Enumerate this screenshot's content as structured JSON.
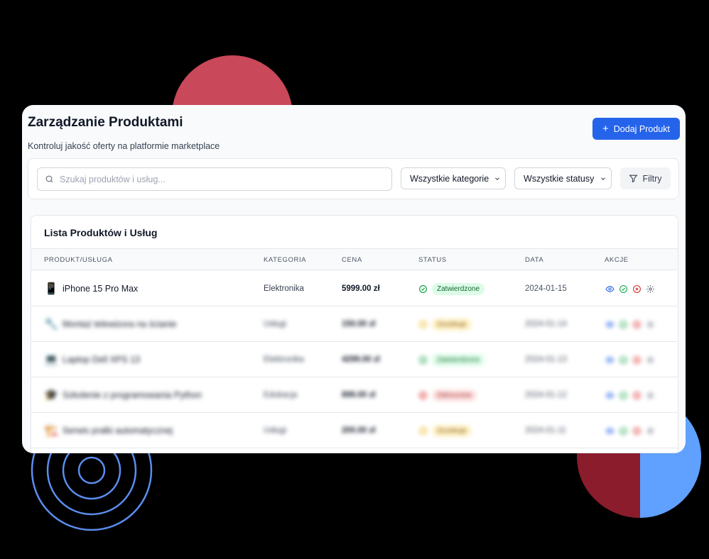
{
  "header": {
    "title": "Zarządzanie Produktami",
    "subtitle": "Kontroluj jakość oferty na platformie marketplace",
    "add_button": "Dodaj Produkt"
  },
  "filters": {
    "search_placeholder": "Szukaj produktów i usług...",
    "category_select": "Wszystkie kategorie",
    "status_select": "Wszystkie statusy",
    "filters_button": "Filtry"
  },
  "list": {
    "title": "Lista Produktów i Usług",
    "columns": [
      "PRODUKT/USŁUGA",
      "KATEGORIA",
      "CENA",
      "STATUS",
      "DATA",
      "AKCJE"
    ],
    "rows": [
      {
        "icon": "📱",
        "name": "iPhone 15 Pro Max",
        "category": "Elektronika",
        "price": "5999.00 zł",
        "status": "Zatwierdzone",
        "date": "2024-01-15"
      },
      {
        "icon": "🔧",
        "name": "Montaż telewizora na ścianie",
        "category": "Usługi",
        "price": "150.00 zł",
        "status": "Oczekuje",
        "date": "2024-01-14"
      },
      {
        "icon": "💻",
        "name": "Laptop Dell XPS 13",
        "category": "Elektronika",
        "price": "4299.00 zł",
        "status": "Zatwierdzone",
        "date": "2024-01-13"
      },
      {
        "icon": "🎓",
        "name": "Szkolenie z programowania Python",
        "category": "Edukacja",
        "price": "899.00 zł",
        "status": "Odrzucone",
        "date": "2024-01-12"
      },
      {
        "icon": "🏗️",
        "name": "Serwis pralki automatycznej",
        "category": "Usługi",
        "price": "200.00 zł",
        "status": "Oczekuje",
        "date": "2024-01-11"
      }
    ]
  },
  "colors": {
    "primary": "#2563eb",
    "approved": "#16a34a",
    "pending": "#eab308",
    "rejected": "#dc2626"
  }
}
